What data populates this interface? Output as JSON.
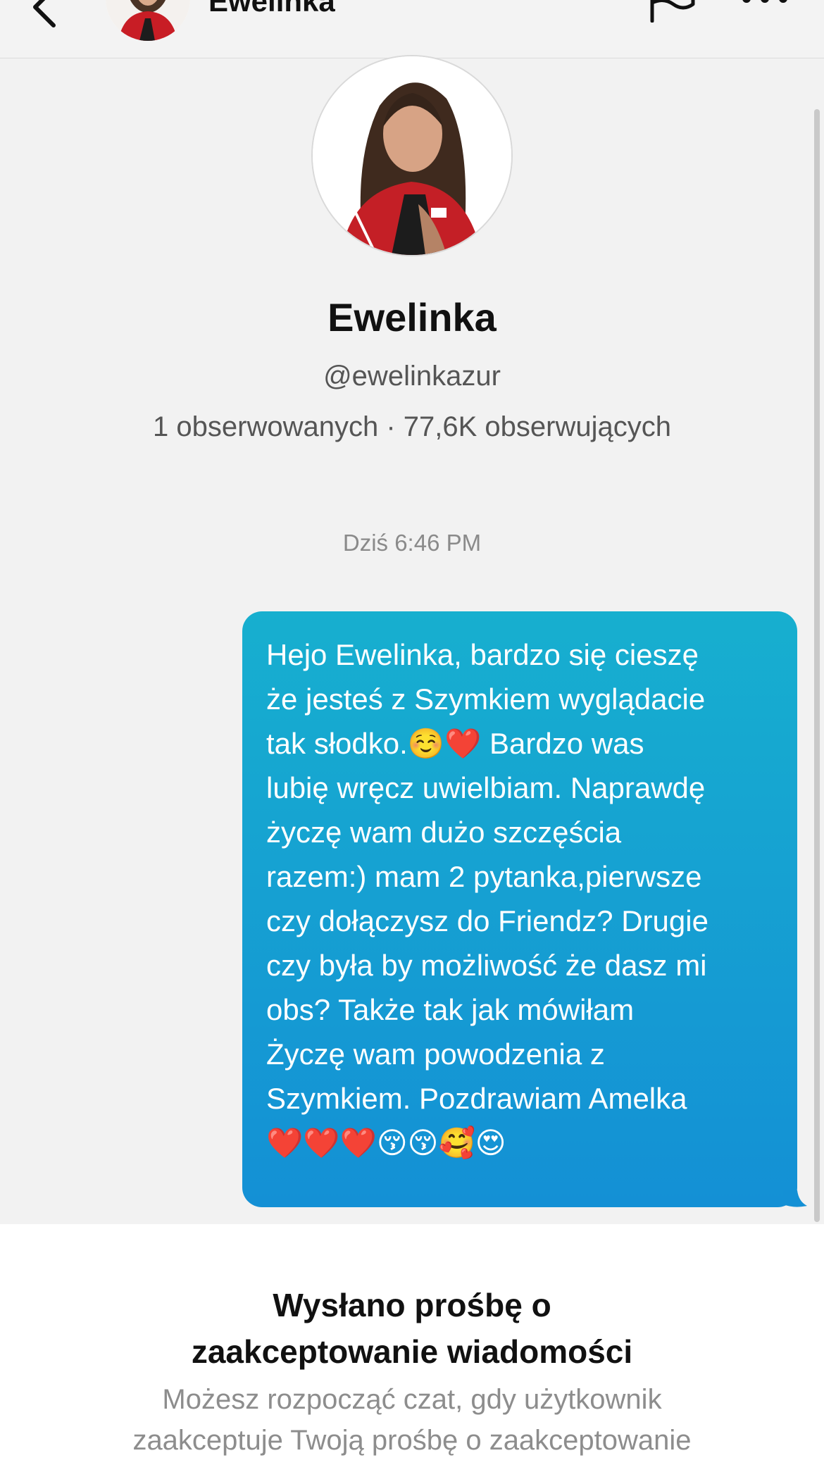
{
  "header": {
    "name": "Ewelinka"
  },
  "profile": {
    "name": "Ewelinka",
    "handle": "@ewelinkazur",
    "stats": "1 obserwowanych · 77,6K obserwujących"
  },
  "chat": {
    "timestamp": "Dziś 6:46 PM",
    "message": "Hejo Ewelinka, bardzo się cieszę\nże jesteś z Szymkiem wyglądacie\ntak słodko.☺️❤️ Bardzo was\nlubię wręcz uwielbiam. Naprawdę\nżyczę wam dużo szczęścia\nrazem:) mam 2 pytanka,pierwsze\nczy dołączysz do Friendz? Drugie\nczy była by możliwość że dasz mi\nobs? Także tak jak mówiłam\nŻyczę wam powodzenia z\nSzymkiem. Pozdrawiam Amelka\n❤️❤️❤️😚😚🥰😍"
  },
  "request": {
    "title": "Wysłano prośbę o\nzaakceptowanie wiadomości",
    "description": "Możesz rozpocząć czat, gdy użytkownik\nzaakceptuje Twoją prośbę o zaakceptowanie"
  },
  "colors": {
    "bubble_top": "#17afcf",
    "bubble_bottom": "#1490d5",
    "background": "#f2f2f2"
  },
  "icons": [
    "back-arrow-icon",
    "flag-icon",
    "more-options-icon"
  ]
}
